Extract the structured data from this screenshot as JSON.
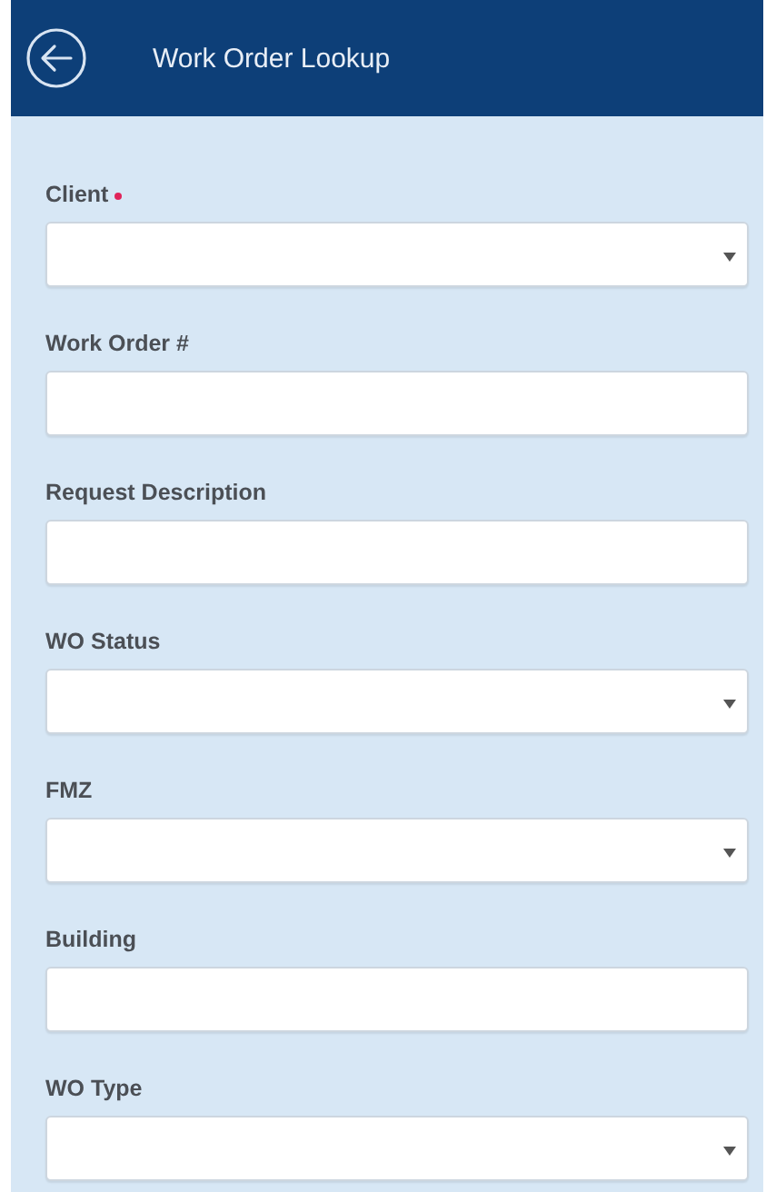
{
  "header": {
    "title": "Work Order Lookup"
  },
  "fields": [
    {
      "label": "Client",
      "kind": "select",
      "required": true
    },
    {
      "label": "Work Order #",
      "kind": "text",
      "required": false
    },
    {
      "label": "Request Description",
      "kind": "text",
      "required": false
    },
    {
      "label": "WO Status",
      "kind": "select",
      "required": false
    },
    {
      "label": "FMZ",
      "kind": "select",
      "required": false
    },
    {
      "label": "Building",
      "kind": "text",
      "required": false
    },
    {
      "label": "WO Type",
      "kind": "select",
      "required": false
    }
  ]
}
